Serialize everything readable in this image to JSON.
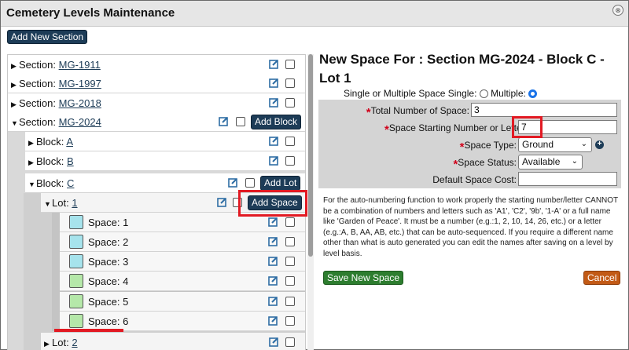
{
  "dialog": {
    "title": "Cemetery Levels Maintenance",
    "close_glyph": "⊗"
  },
  "toolbar": {
    "add_section_label": "Add New Section"
  },
  "tree": {
    "section_prefix": "Section:",
    "block_prefix": "Block:",
    "lot_prefix": "Lot:",
    "space_prefix": "Space:",
    "sections": [
      "MG-1911",
      "MG-1997",
      "MG-2018",
      "MG-2024"
    ],
    "add_block_label": "Add Block",
    "blocks": [
      "A",
      "B",
      "C"
    ],
    "add_lot_label": "Add Lot",
    "lots": [
      "1",
      "2"
    ],
    "add_space_label": "Add Space",
    "spaces": [
      "1",
      "2",
      "3",
      "4",
      "5",
      "6"
    ]
  },
  "colors": {
    "space_available": "#a6e3ec",
    "space_new": "#b5e8a9",
    "accent": "#1d3c57",
    "highlight": "#e21a23"
  },
  "form": {
    "title": "New Space For : Section MG-2024 - Block C - Lot 1",
    "mode_label": "Single or Multiple Space",
    "single_label": "Single:",
    "multiple_label": "Multiple:",
    "selected_mode": "Multiple",
    "total_label": "Total Number of Space:",
    "total_value": "3",
    "start_label": "Space Starting Number or Letter:",
    "start_value": "7",
    "type_label": "Space Type:",
    "type_value": "Ground",
    "status_label": "Space Status:",
    "status_value": "Available",
    "cost_label": "Default Space Cost:",
    "cost_value": "",
    "info_text": "For the auto-numbering function to work properly the starting number/letter CANNOT be a combination of numbers and letters such as 'A1', 'C2', '9b', '1-A' or a full name like 'Garden of Peace'. It must be a number (e.g.:1, 2, 10, 14, 26, etc.) or a letter (e.g.:A, B, AA, AB, etc.) that can be auto-sequenced. If you require a different name other than what is auto generated you can edit the names after saving on a level by level basis.",
    "save_label": "Save New Space",
    "cancel_label": "Cancel"
  }
}
